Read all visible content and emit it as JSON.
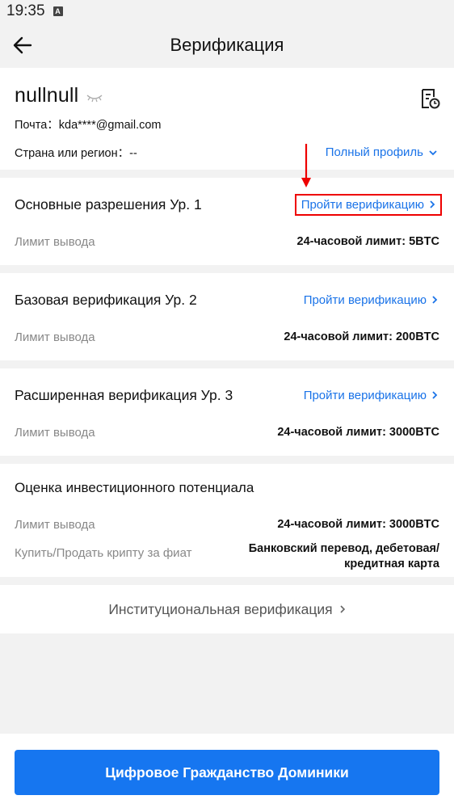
{
  "status_bar": {
    "time": "19:35",
    "indicator": "A"
  },
  "header": {
    "title": "Верификация"
  },
  "profile": {
    "username": "nullnull",
    "email_label": "Почта：",
    "email_value": "kda****@gmail.com",
    "country_label": "Страна или регион：",
    "country_value": "--",
    "full_profile_link": "Полный профиль"
  },
  "levels": [
    {
      "title": "Основные разрешения Ур. 1",
      "action": "Пройти верификацию",
      "limit_label": "Лимит вывода",
      "limit_value": "24-часовой лимит: 5BTC"
    },
    {
      "title": "Базовая верификация Ур. 2",
      "action": "Пройти верификацию",
      "limit_label": "Лимит вывода",
      "limit_value": "24-часовой лимит: 200BTC"
    },
    {
      "title": "Расширенная верификация Ур. 3",
      "action": "Пройти верификацию",
      "limit_label": "Лимит вывода",
      "limit_value": "24-часовой лимит: 3000BTC"
    }
  ],
  "investment": {
    "title": "Оценка инвестиционного потенциала",
    "limit_label": "Лимит вывода",
    "limit_value": "24-часовой лимит: 3000BTC",
    "fiat_label": "Купить/Продать крипту за фиат",
    "fiat_value_line1": "Банковский перевод, дебетовая/",
    "fiat_value_line2": "кредитная карта"
  },
  "institutional": {
    "label": "Институциональная верификация"
  },
  "cta": {
    "label": "Цифровое Гражданство Доминики"
  },
  "colors": {
    "accent": "#1a73e8",
    "button": "#1676f0",
    "annotation": "#e00000",
    "background": "#f2f2f2"
  }
}
